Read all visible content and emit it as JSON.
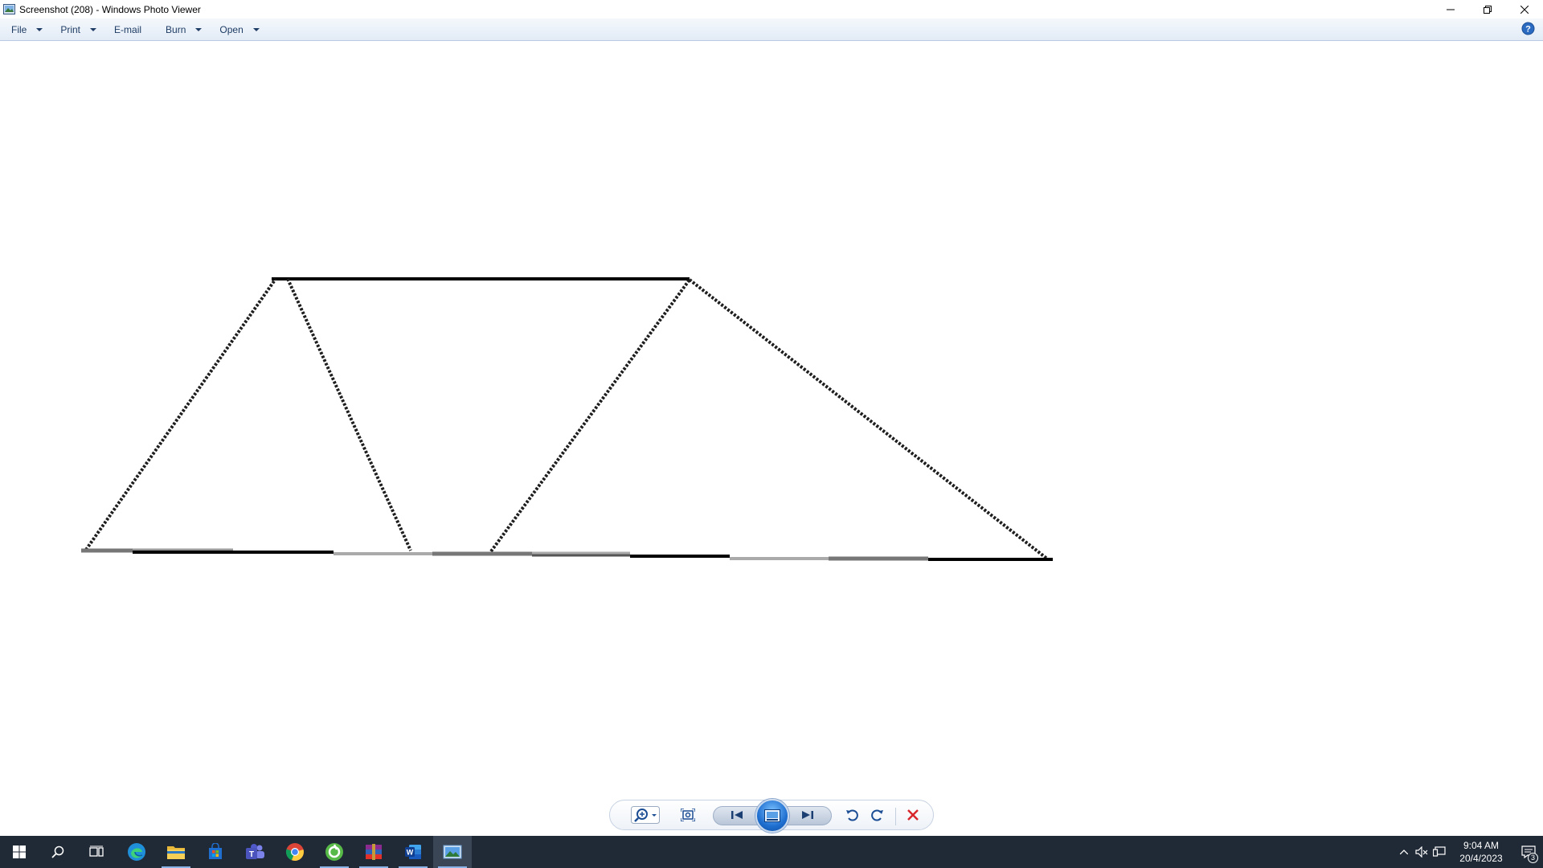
{
  "window": {
    "title": "Screenshot (208) - Windows Photo Viewer"
  },
  "menu": {
    "items": [
      {
        "label": "File",
        "has_dropdown": true
      },
      {
        "label": "Print",
        "has_dropdown": true
      },
      {
        "label": "E-mail",
        "has_dropdown": false
      },
      {
        "label": "Burn",
        "has_dropdown": true
      },
      {
        "label": "Open",
        "has_dropdown": true
      }
    ],
    "help_icon": "help-icon"
  },
  "controls": {
    "zoom_icon": "zoom-icon",
    "actual_size_icon": "actual-size-icon",
    "previous_icon": "previous-icon",
    "slideshow_icon": "slideshow-icon",
    "next_icon": "next-icon",
    "rotate_ccw_icon": "rotate-counterclockwise-icon",
    "rotate_cw_icon": "rotate-clockwise-icon",
    "delete_icon": "delete-icon"
  },
  "taskbar": {
    "apps": [
      {
        "name": "start",
        "icon": "windows-start-icon"
      },
      {
        "name": "search",
        "icon": "search-icon"
      },
      {
        "name": "task-view",
        "icon": "task-view-icon"
      },
      {
        "name": "edge",
        "icon": "edge-icon"
      },
      {
        "name": "file-explorer",
        "icon": "folder-icon"
      },
      {
        "name": "store",
        "icon": "store-icon"
      },
      {
        "name": "teams",
        "icon": "teams-icon"
      },
      {
        "name": "chrome",
        "icon": "chrome-icon"
      },
      {
        "name": "app-green",
        "icon": "green-app-icon"
      },
      {
        "name": "winrar",
        "icon": "winrar-icon"
      },
      {
        "name": "word",
        "icon": "word-icon"
      },
      {
        "name": "photo-viewer",
        "icon": "photo-viewer-icon"
      }
    ],
    "clock": {
      "time": "9:04 AM",
      "date": "20/4/2023"
    },
    "notification_count": "3"
  },
  "colors": {
    "menubar_text": "#1e3c64",
    "taskbar_bg": "#202a36",
    "slideshow_blue": "#1f6fd0",
    "delete_red": "#d8262d"
  }
}
